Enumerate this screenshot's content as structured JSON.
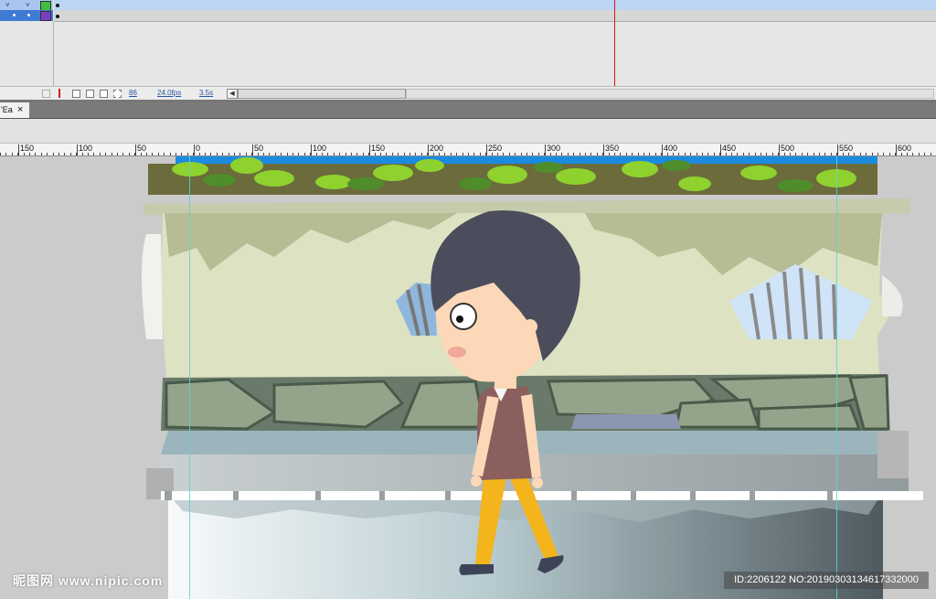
{
  "colors": {
    "layer1_swatch": "#3fbf3f",
    "layer2_swatch": "#7b3fbf",
    "selected_layer": "#3f7ad3",
    "playhead": "#d01818",
    "guide": "#5fd2d2",
    "sky": "#1b8be0",
    "wall": "#dde2c3",
    "hair": "#4b4d5c",
    "skin": "#fcd8b8",
    "shirt": "#8b5f5d",
    "pants": "#f4b41c"
  },
  "timeline": {
    "frame_number": "86",
    "fps": "24.0fps",
    "time": "3.5s",
    "toolbar_icons": [
      "onion-skin-icon",
      "onion-outline-icon",
      "edit-multiple-icon",
      "onion-markers-icon"
    ]
  },
  "document_tab": {
    "label": "'Ea",
    "close": "×"
  },
  "ruler_labels": [
    "150",
    "100",
    "50",
    "0",
    "50",
    "100",
    "150",
    "200",
    "250",
    "300",
    "350",
    "400",
    "450",
    "500",
    "550",
    "600"
  ],
  "watermark": {
    "left": "昵图网 www.nipic.com",
    "right": "ID:2206122 NO:20190303134617332000"
  }
}
